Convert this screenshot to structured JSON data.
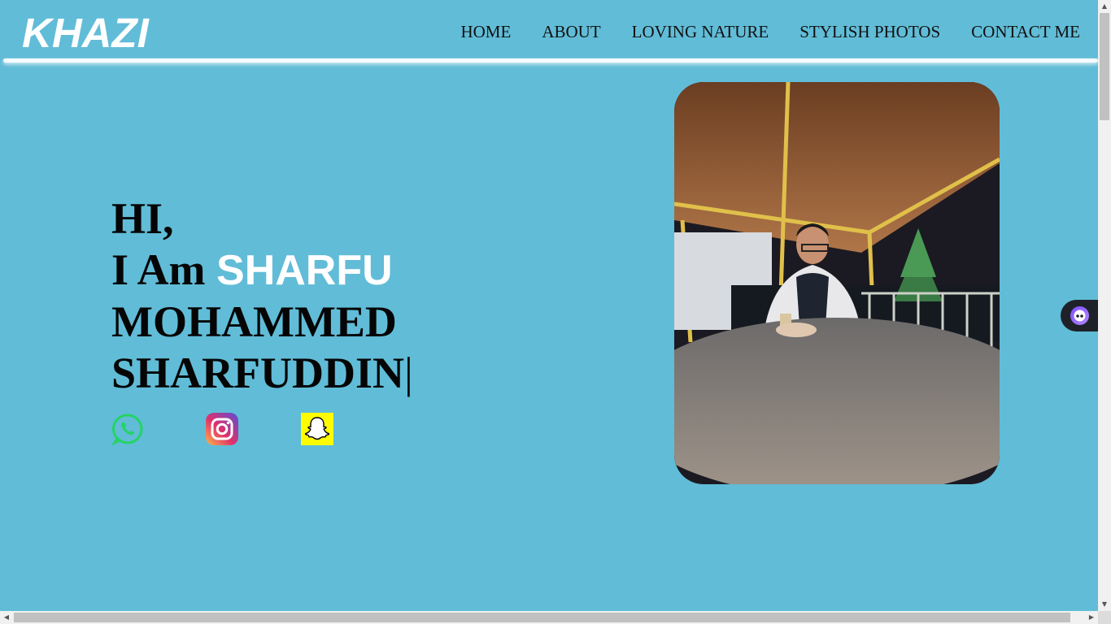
{
  "header": {
    "logo": "KHAZI",
    "nav": [
      {
        "label": "HOME"
      },
      {
        "label": "ABOUT"
      },
      {
        "label": "LOVING NATURE"
      },
      {
        "label": "STYLISH PHOTOS"
      },
      {
        "label": "CONTACT ME"
      }
    ]
  },
  "hero": {
    "greeting": "HI,",
    "intro": "I Am",
    "highlight": "SHARFU",
    "name_line1": "MOHAMMED",
    "name_line2": "SHARFUDDIN",
    "cursor": "|"
  },
  "social": [
    {
      "icon": "whatsapp-icon",
      "color": "#25d366"
    },
    {
      "icon": "instagram-icon",
      "color": "#d6249f"
    },
    {
      "icon": "snapchat-icon",
      "color": "#fffc00"
    }
  ],
  "colors": {
    "background": "#61bcd7",
    "logo": "#ffffff",
    "highlight": "#ffffff",
    "text": "#050505"
  }
}
